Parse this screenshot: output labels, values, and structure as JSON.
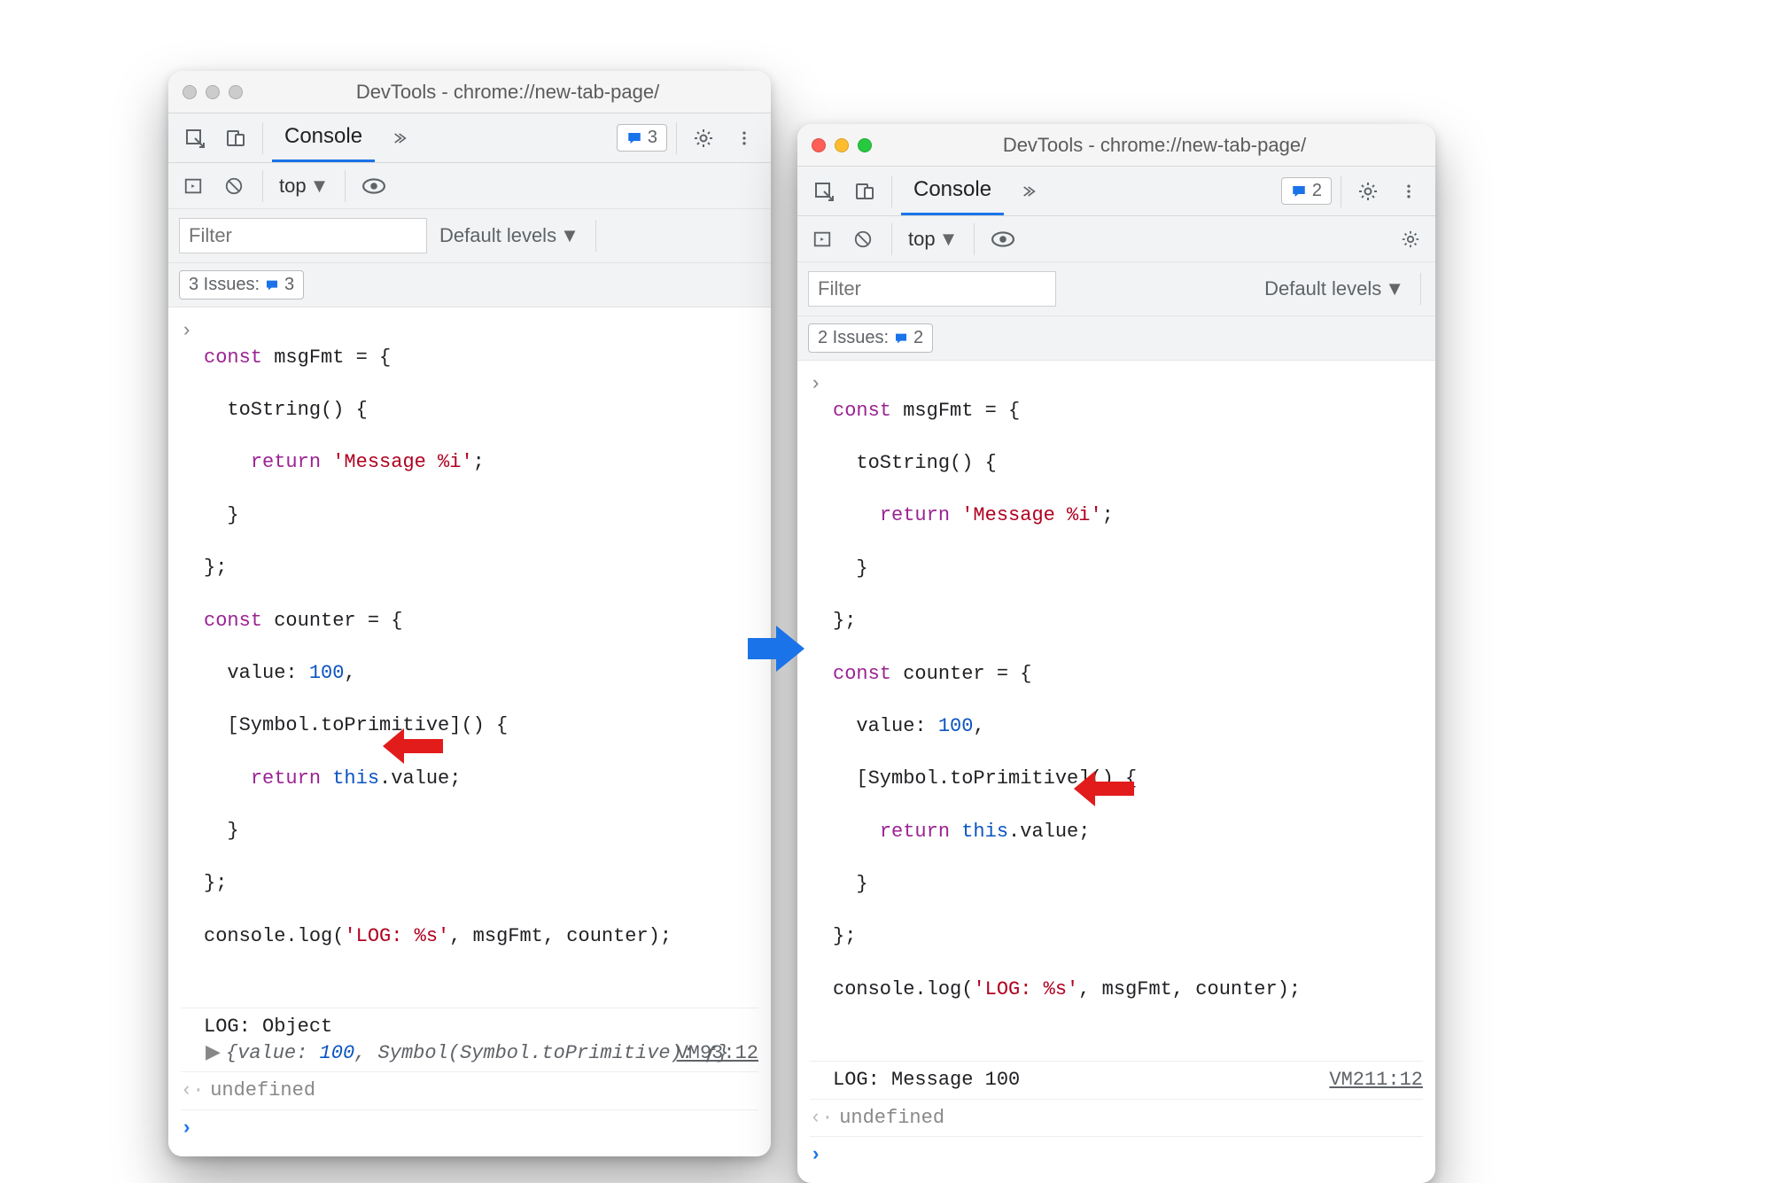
{
  "windows": {
    "left": {
      "title": "DevTools - chrome://new-tab-page/",
      "traffic_colored": false,
      "tab": "Console",
      "issues_badge": "3",
      "filter_placeholder": "Filter",
      "default_levels": "Default levels",
      "issues_chip_label": "3 Issues:",
      "issues_chip_count": "3",
      "context": "top",
      "source_link": "VM93:12",
      "log_output": "LOG: Object",
      "expand_text": "{value: 100, Symbol(Symbol.toPrimitive): ƒ}",
      "undefined_label": "undefined",
      "code": {
        "l1_a": "const",
        "l1_b": " msgFmt = {",
        "l2": "  toString() {",
        "l3_a": "    ",
        "l3_b": "return",
        "l3_c": " ",
        "l3_d": "'Message %i'",
        "l3_e": ";",
        "l4": "  }",
        "l5": "};",
        "l6_a": "const",
        "l6_b": " counter = {",
        "l7_a": "  value: ",
        "l7_b": "100",
        "l7_c": ",",
        "l8": "  [Symbol.toPrimitive]() {",
        "l9_a": "    ",
        "l9_b": "return",
        "l9_c": " ",
        "l9_d": "this",
        "l9_e": ".value;",
        "l10": "  }",
        "l11": "};",
        "l12_a": "console.log(",
        "l12_b": "'LOG: %s'",
        "l12_c": ", msgFmt, counter);"
      }
    },
    "right": {
      "title": "DevTools - chrome://new-tab-page/",
      "traffic_colored": true,
      "tab": "Console",
      "issues_badge": "2",
      "filter_placeholder": "Filter",
      "default_levels": "Default levels",
      "issues_chip_label": "2 Issues:",
      "issues_chip_count": "2",
      "context": "top",
      "source_link": "VM211:12",
      "log_output": "LOG: Message 100",
      "undefined_label": "undefined",
      "code": {
        "l1_a": "const",
        "l1_b": " msgFmt = {",
        "l2": "  toString() {",
        "l3_a": "    ",
        "l3_b": "return",
        "l3_c": " ",
        "l3_d": "'Message %i'",
        "l3_e": ";",
        "l4": "  }",
        "l5": "};",
        "l6_a": "const",
        "l6_b": " counter = {",
        "l7_a": "  value: ",
        "l7_b": "100",
        "l7_c": ",",
        "l8": "  [Symbol.toPrimitive]() {",
        "l9_a": "    ",
        "l9_b": "return",
        "l9_c": " ",
        "l9_d": "this",
        "l9_e": ".value;",
        "l10": "  }",
        "l11": "};",
        "l12_a": "console.log(",
        "l12_b": "'LOG: %s'",
        "l12_c": ", msgFmt, counter);"
      }
    }
  }
}
